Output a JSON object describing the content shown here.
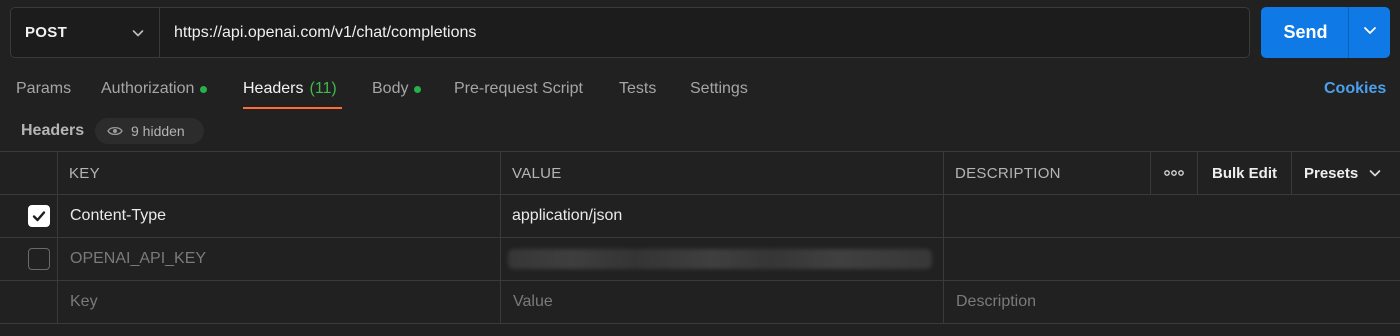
{
  "request": {
    "method": "POST",
    "url": "https://api.openai.com/v1/chat/completions",
    "send_label": "Send"
  },
  "tabs": [
    {
      "label": "Params"
    },
    {
      "label": "Authorization"
    },
    {
      "label": "Headers",
      "count": "(11)"
    },
    {
      "label": "Body"
    },
    {
      "label": "Pre-request Script"
    },
    {
      "label": "Tests"
    },
    {
      "label": "Settings"
    }
  ],
  "cookies_label": "Cookies",
  "headers_section": {
    "title": "Headers",
    "hidden_label": "9 hidden"
  },
  "table": {
    "columns": {
      "key": "KEY",
      "value": "VALUE",
      "description": "DESCRIPTION"
    },
    "bulk_edit_label": "Bulk Edit",
    "presets_label": "Presets",
    "rows": [
      {
        "checked": true,
        "key": "Content-Type",
        "value": "application/json",
        "description": ""
      },
      {
        "checked": false,
        "key": "OPENAI_API_KEY",
        "value": "",
        "description": ""
      }
    ],
    "placeholders": {
      "key": "Key",
      "value": "Value",
      "description": "Description"
    }
  },
  "colors": {
    "accent": "#0f7ae5",
    "active_tab_underline": "#ff6c37",
    "status_dot": "#26b14b",
    "cookies_link": "#4b9fee"
  }
}
